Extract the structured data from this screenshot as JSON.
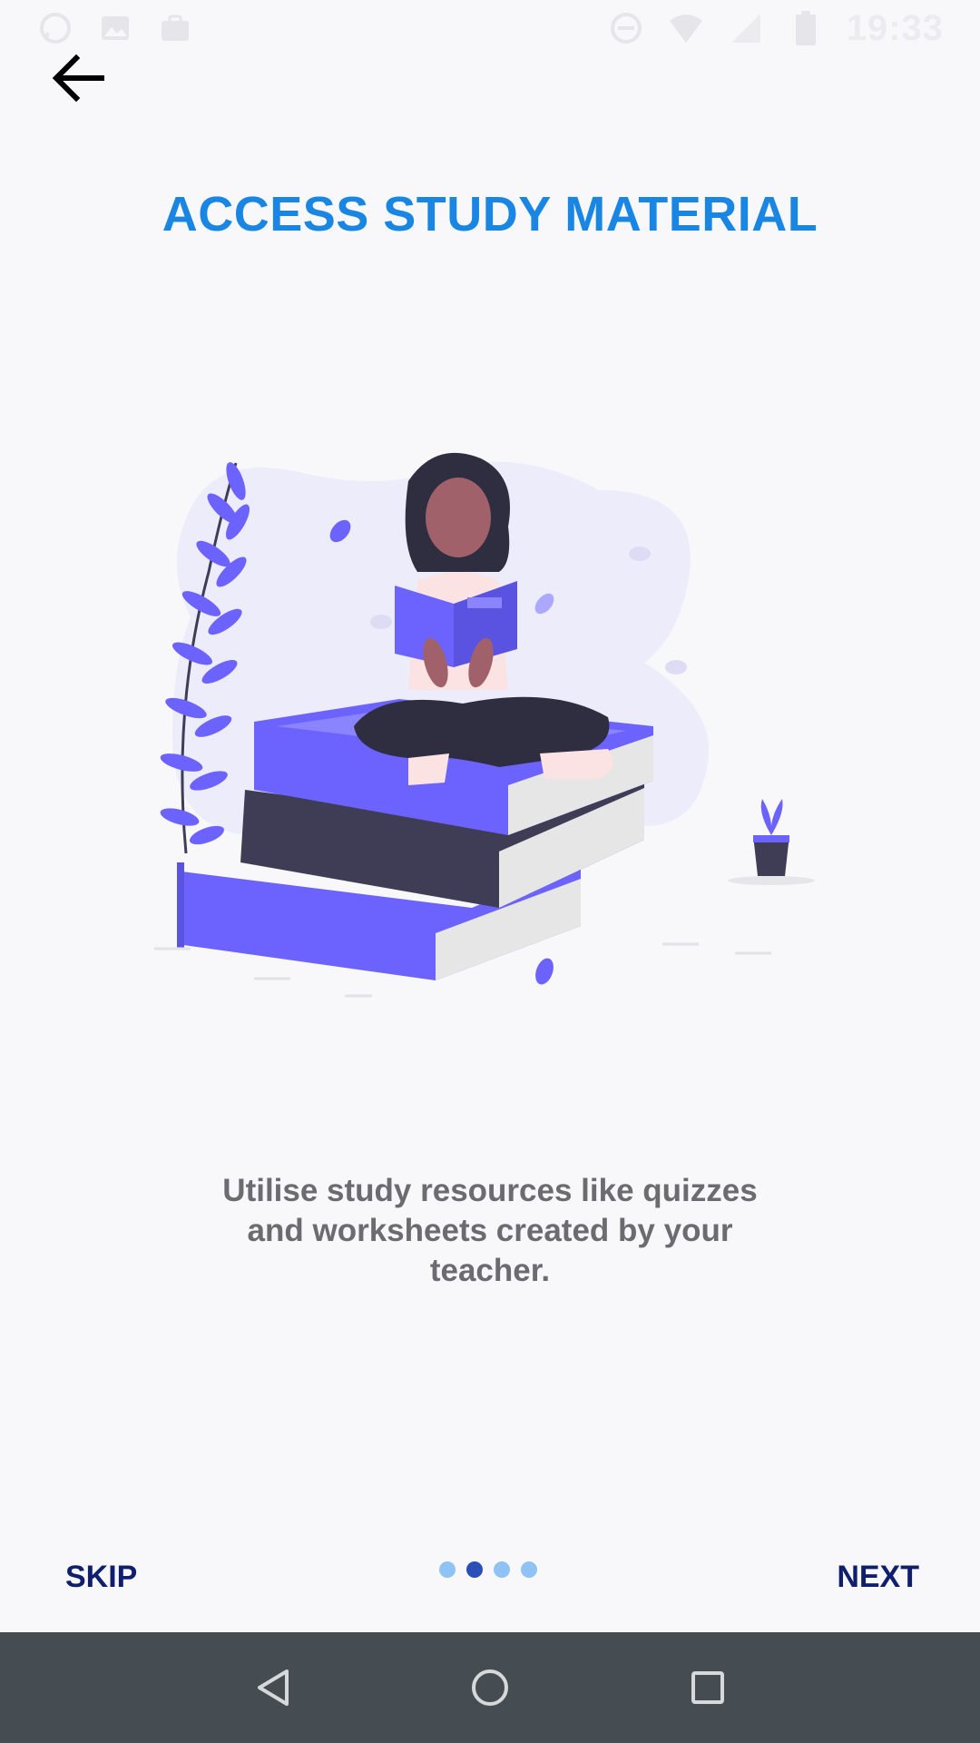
{
  "status_bar": {
    "time": "19:33",
    "left_icons": [
      "whatsapp-icon",
      "image-icon",
      "briefcase-icon"
    ],
    "right_icons": [
      "do-not-disturb-icon",
      "wifi-icon",
      "signal-icon",
      "battery-icon"
    ]
  },
  "header": {
    "back_icon": "arrow-left-icon",
    "title": "ACCESS STUDY MATERIAL"
  },
  "main": {
    "description": "Utilise study resources like quizzes and worksheets created by your teacher.",
    "illustration": "woman-reading-on-books-illustration"
  },
  "footer": {
    "skip_label": "SKIP",
    "next_label": "NEXT",
    "pagination": {
      "total": 4,
      "current": 2
    }
  },
  "colors": {
    "title": "#1a86e3",
    "button_text": "#0f1f6e",
    "description": "#6b6b70",
    "dot_active": "#2a4fb8",
    "dot_inactive": "#8fc3f5",
    "nav_bar": "#454c52",
    "illustration_accent": "#6c63ff"
  },
  "nav_bar": {
    "buttons": [
      "back-triangle-icon",
      "home-circle-icon",
      "recents-square-icon"
    ]
  }
}
